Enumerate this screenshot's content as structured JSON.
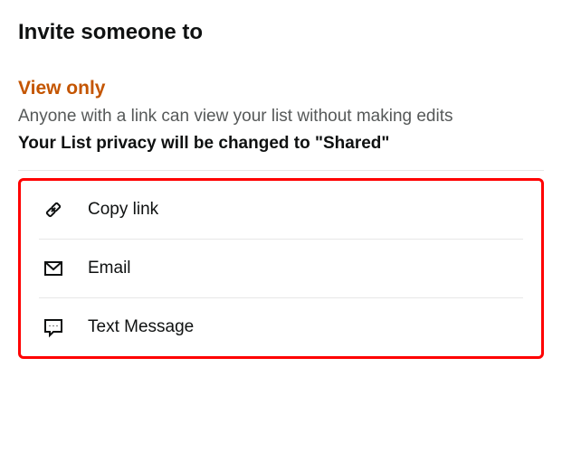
{
  "header": {
    "title": "Invite someone to"
  },
  "section": {
    "title": "View only",
    "description": "Anyone with a link can view your list without making edits",
    "warning": "Your List privacy will be changed to \"Shared\""
  },
  "options": {
    "copy_link": "Copy link",
    "email": "Email",
    "text_message": "Text Message"
  }
}
